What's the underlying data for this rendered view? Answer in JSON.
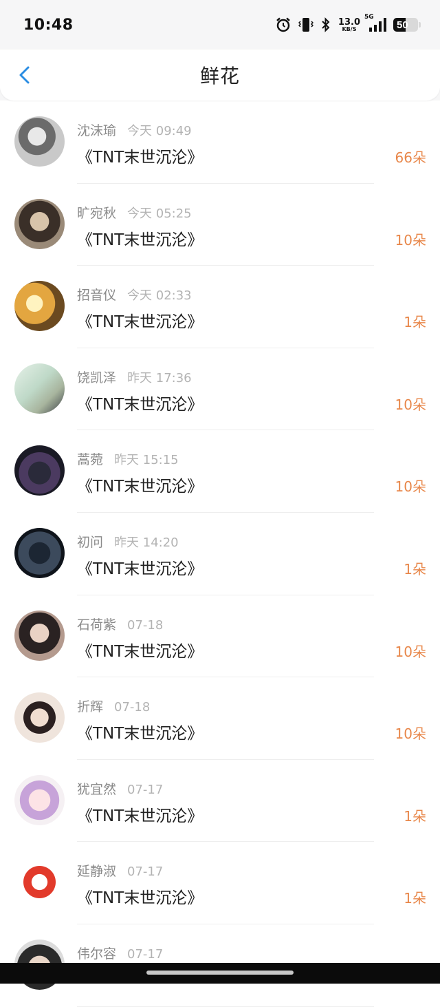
{
  "status_bar": {
    "time": "10:48",
    "net_speed_value": "13.0",
    "net_speed_unit": "KB/S",
    "network": "5G",
    "battery": "50",
    "battery_level": 0.5,
    "icons": [
      "alarm-icon",
      "vibrate-icon",
      "bluetooth-icon",
      "signal-icon",
      "battery-icon"
    ]
  },
  "header": {
    "title": "鲜花",
    "back_icon": "chevron-left-icon",
    "accent_color": "#2b8de3"
  },
  "count_color": "#e8874a",
  "items": [
    {
      "name": "沈沫瑜",
      "date": "今天 09:49",
      "book": "《TNT末世沉沦》",
      "count": "66朵"
    },
    {
      "name": "旷宛秋",
      "date": "今天 05:25",
      "book": "《TNT末世沉沦》",
      "count": "10朵"
    },
    {
      "name": "招音仪",
      "date": "今天 02:33",
      "book": "《TNT末世沉沦》",
      "count": "1朵"
    },
    {
      "name": "饶凯泽",
      "date": "昨天 17:36",
      "book": "《TNT末世沉沦》",
      "count": "10朵"
    },
    {
      "name": "蒿菀",
      "date": "昨天 15:15",
      "book": "《TNT末世沉沦》",
      "count": "10朵"
    },
    {
      "name": "初问",
      "date": "昨天 14:20",
      "book": "《TNT末世沉沦》",
      "count": "1朵"
    },
    {
      "name": "石荷紫",
      "date": "07-18",
      "book": "《TNT末世沉沦》",
      "count": "10朵"
    },
    {
      "name": "折辉",
      "date": "07-18",
      "book": "《TNT末世沉沦》",
      "count": "10朵"
    },
    {
      "name": "犹宜然",
      "date": "07-17",
      "book": "《TNT末世沉沦》",
      "count": "1朵"
    },
    {
      "name": "延静淑",
      "date": "07-17",
      "book": "《TNT末世沉沦》",
      "count": "1朵"
    },
    {
      "name": "伟尔容",
      "date": "07-17",
      "book": "",
      "count": ""
    }
  ]
}
